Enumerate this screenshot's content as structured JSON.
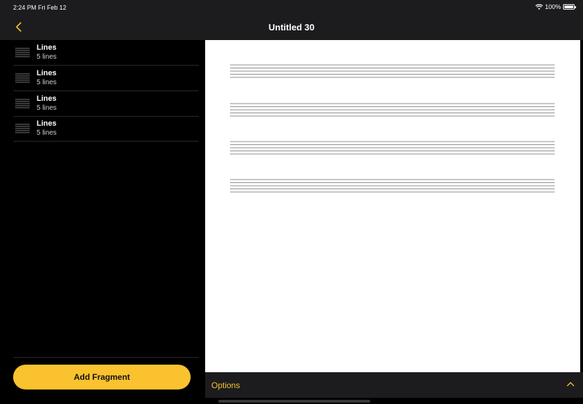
{
  "status_bar": {
    "time": "2:24 PM  Fri Feb 12",
    "battery": "100%",
    "icons": [
      "wifi-icon",
      "battery-icon"
    ]
  },
  "nav": {
    "title": "Untitled 30",
    "back_icon": "chevron-left-icon"
  },
  "sidebar": {
    "items": [
      {
        "title": "Lines",
        "subtitle": "5 lines",
        "icon": "lines-icon"
      },
      {
        "title": "Lines",
        "subtitle": "5 lines",
        "icon": "lines-icon"
      },
      {
        "title": "Lines",
        "subtitle": "5 lines",
        "icon": "lines-icon"
      },
      {
        "title": "Lines",
        "subtitle": "5 lines",
        "icon": "lines-icon"
      }
    ],
    "add_button_label": "Add Fragment"
  },
  "canvas": {
    "staff_count": 4,
    "lines_per_staff": 5
  },
  "options": {
    "label": "Options",
    "icon": "chevron-up-icon"
  },
  "colors": {
    "accent": "#f9c22e",
    "bar_background": "#1c1c1e",
    "sidebar_background": "#000000",
    "canvas_background": "#ffffff"
  }
}
